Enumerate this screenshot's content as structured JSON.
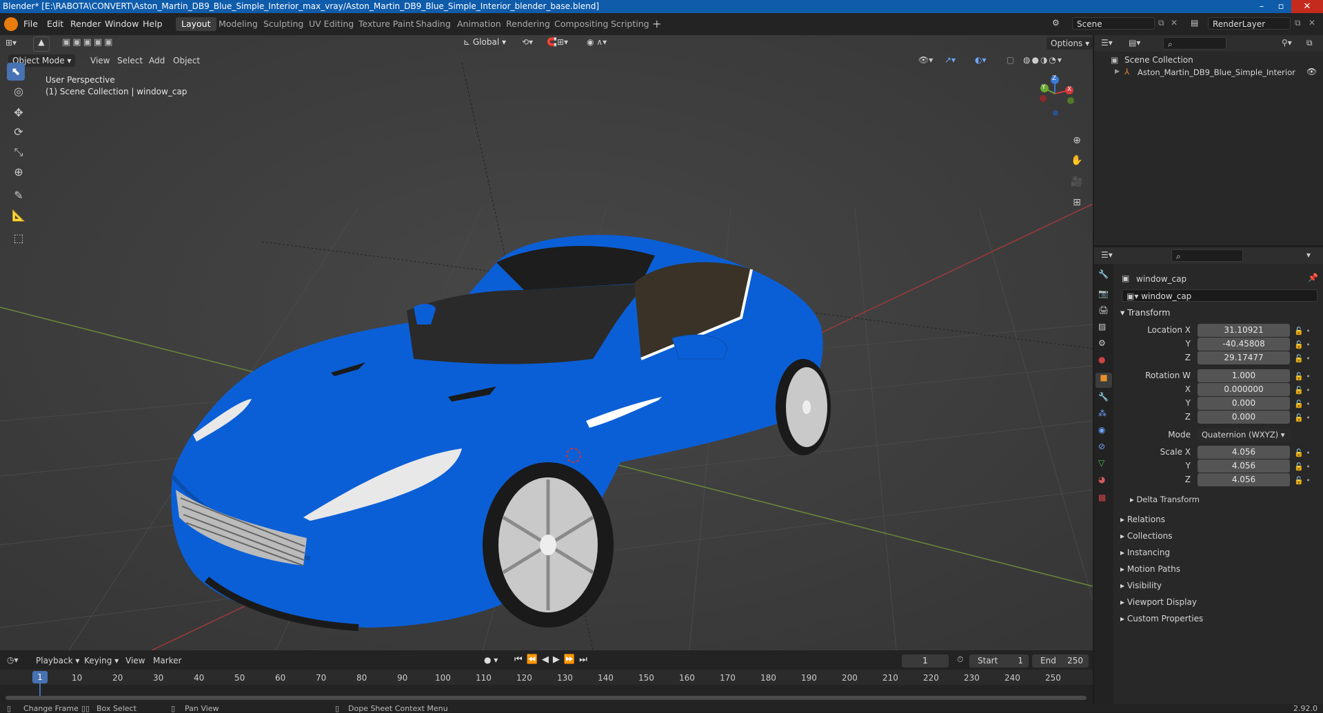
{
  "window": {
    "title": "Blender* [E:\\RABOTA\\CONVERT\\Aston_Martin_DB9_Blue_Simple_Interior_max_vray/Aston_Martin_DB9_Blue_Simple_Interior_blender_base.blend]"
  },
  "menu": [
    "File",
    "Edit",
    "Render",
    "Window",
    "Help"
  ],
  "workspaces": [
    "Layout",
    "Modeling",
    "Sculpting",
    "UV Editing",
    "Texture Paint",
    "Shading",
    "Animation",
    "Rendering",
    "Compositing",
    "Scripting"
  ],
  "active_workspace": "Layout",
  "scene": {
    "name": "Scene",
    "render_layer": "RenderLayer"
  },
  "viewport": {
    "mode": "Object Mode",
    "menus": [
      "View",
      "Select",
      "Add",
      "Object"
    ],
    "orientation": "Global",
    "options_label": "Options",
    "info_line1": "User Perspective",
    "info_line2": "(1) Scene Collection | window_cap",
    "gizmo": {
      "x": "X",
      "y": "Y",
      "z": "Z"
    }
  },
  "outliner": {
    "root": "Scene Collection",
    "items": [
      "Aston_Martin_DB9_Blue_Simple_Interior"
    ]
  },
  "properties": {
    "object_name": "window_cap",
    "data_name": "window_cap",
    "transform_label": "Transform",
    "location_label": "Location X",
    "location": {
      "x": "31.10921",
      "y": "-40.45808",
      "z": "29.17477"
    },
    "rotation_label": "Rotation W",
    "rotation": {
      "w": "1.000",
      "x": "0.000000",
      "y": "0.000",
      "z": "0.000"
    },
    "mode_label": "Mode",
    "mode_value": "Quaternion (WXYZ)",
    "scale_label": "Scale X",
    "scale": {
      "x": "4.056",
      "y": "4.056",
      "z": "4.056"
    },
    "axis_y": "Y",
    "axis_z": "Z",
    "axis_x": "X",
    "delta": "Delta Transform",
    "panels": [
      "Relations",
      "Collections",
      "Instancing",
      "Motion Paths",
      "Visibility",
      "Viewport Display",
      "Custom Properties"
    ]
  },
  "timeline": {
    "menus": [
      "Playback",
      "Keying",
      "View",
      "Marker"
    ],
    "current_frame": "1",
    "start_label": "Start",
    "start": "1",
    "end_label": "End",
    "end": "250",
    "ticks": [
      "1",
      "10",
      "20",
      "30",
      "40",
      "50",
      "60",
      "70",
      "80",
      "90",
      "100",
      "110",
      "120",
      "130",
      "140",
      "150",
      "160",
      "170",
      "180",
      "190",
      "200",
      "210",
      "220",
      "230",
      "240",
      "250"
    ]
  },
  "statusbar": {
    "items": [
      "Change Frame",
      "Box Select",
      "Pan View",
      "Dope Sheet Context Menu"
    ],
    "version": "2.92.0"
  },
  "colors": {
    "accent": "#4772b3",
    "car_body": "#0b5fd6",
    "titlebar": "#0f5cab"
  }
}
